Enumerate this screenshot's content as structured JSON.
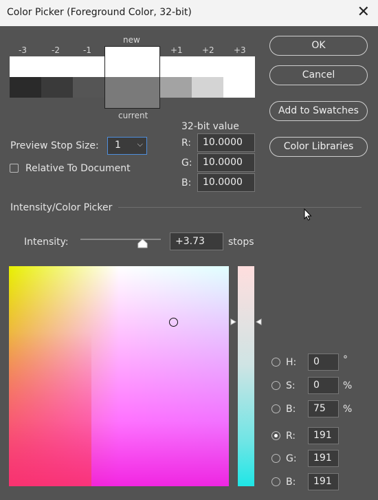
{
  "window": {
    "title": "Color Picker (Foreground Color, 32-bit)"
  },
  "stops": {
    "labels": [
      "-3",
      "-2",
      "-1",
      "new",
      "+1",
      "+2",
      "+3"
    ],
    "current_label": "current"
  },
  "buttons": {
    "ok": "OK",
    "cancel": "Cancel",
    "add_to_swatches": "Add to Swatches",
    "color_libraries": "Color Libraries"
  },
  "preview": {
    "stop_size_label": "Preview Stop Size:",
    "stop_size_value": "1",
    "relative_label": "Relative To Document"
  },
  "bit32": {
    "heading": "32-bit value",
    "r_label": "R:",
    "r_value": "10.0000",
    "g_label": "G:",
    "g_value": "10.0000",
    "b_label": "B:",
    "b_value": "10.0000"
  },
  "section": {
    "title": "Intensity/Color Picker"
  },
  "intensity": {
    "label": "Intensity:",
    "value": "+3.73",
    "unit": "stops"
  },
  "hsb": {
    "h_label": "H:",
    "h_value": "0",
    "h_unit": "°",
    "s_label": "S:",
    "s_value": "0",
    "s_unit": "%",
    "b_label": "B:",
    "b_value": "75",
    "b_unit": "%"
  },
  "rgb": {
    "r_label": "R:",
    "r_value": "191",
    "g_label": "G:",
    "g_value": "191",
    "b_label": "B:",
    "b_value": "191"
  },
  "colors": {
    "new_color": "#ffffff",
    "current_color": "#7a7a7a",
    "stop_top": "#ffffff",
    "stop_minus3": "#2a2a2a",
    "stop_minus2": "#3a3a3a",
    "stop_minus1": "#555555",
    "stop_plus1": "#a3a3a3",
    "stop_plus2": "#d4d4d4",
    "stop_plus3": "#ffffff"
  }
}
